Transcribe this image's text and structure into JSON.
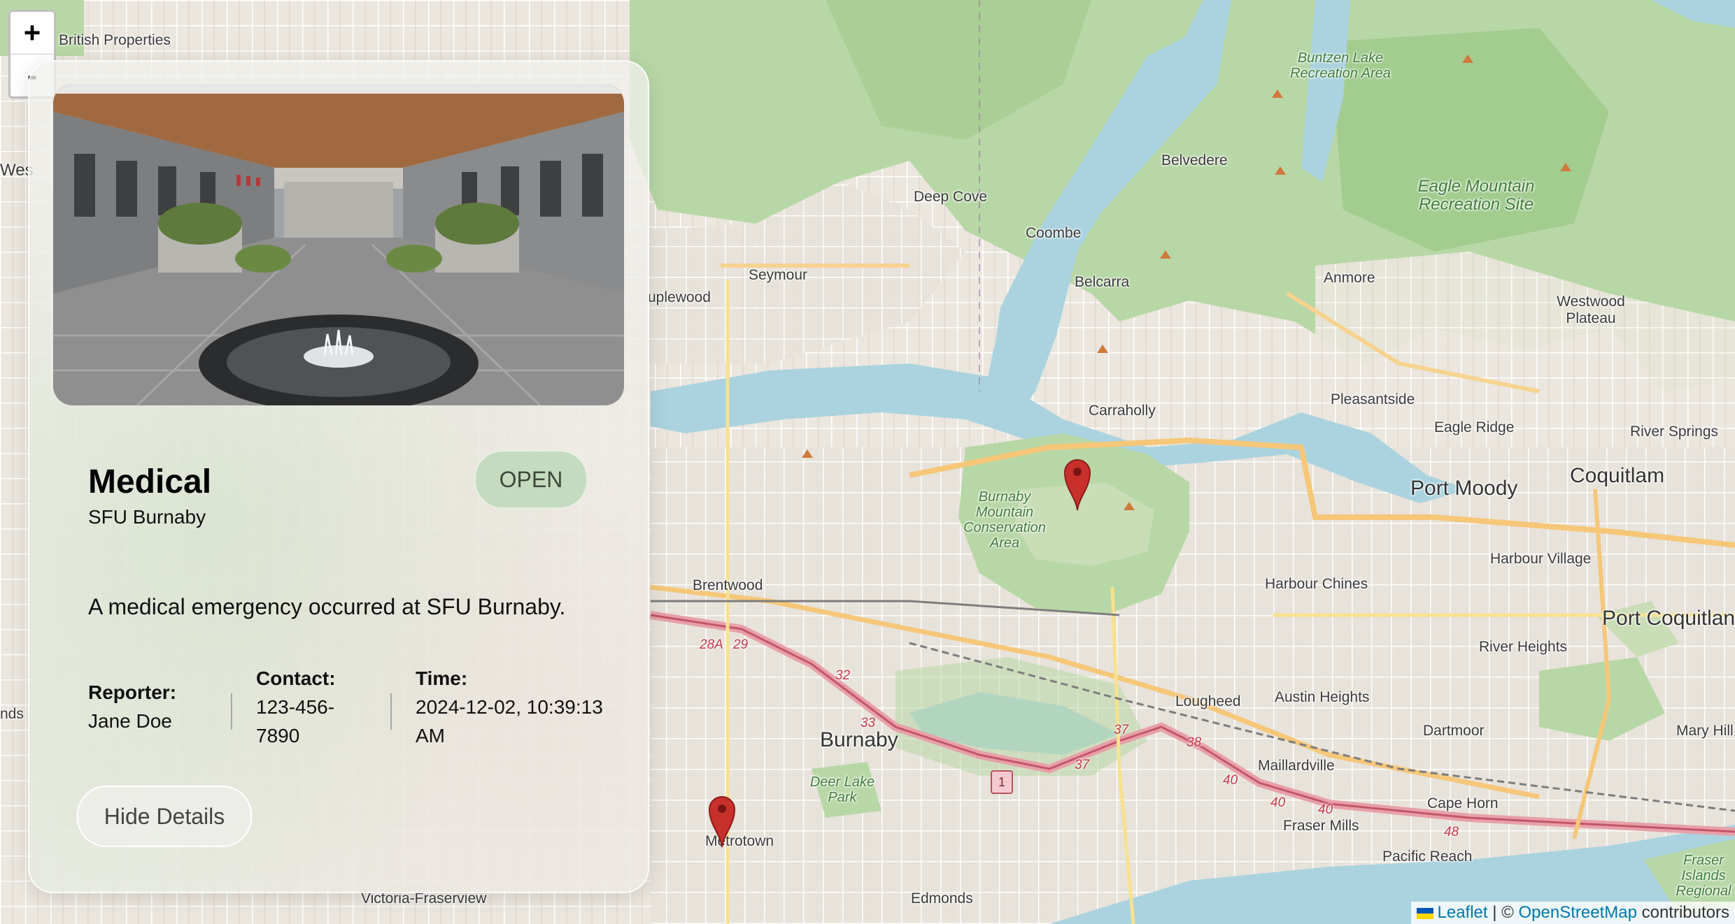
{
  "map": {
    "zoom_in_label": "+",
    "zoom_out_label": "-",
    "labels": {
      "british_properties": "British Properties",
      "west": "Wes",
      "uplewood": "uplewood",
      "seymour": "Seymour",
      "deep_cove": "Deep Cove",
      "coombe": "Coombe",
      "belvedere": "Belvedere",
      "belcarra": "Belcarra",
      "anmore": "Anmore",
      "westwood_plateau": "Westwood Plateau",
      "buntzen": "Buntzen Lake Recreation Area",
      "eagle_mountain": "Eagle Mountain Recreation Site",
      "carraholly": "Carraholly",
      "pleasantside": "Pleasantside",
      "eagle_ridge": "Eagle Ridge",
      "river_springs": "River Springs",
      "port_moody": "Port Moody",
      "coquitlam": "Coquitlam",
      "burnaby_mountain": "Burnaby Mountain Conservation Area",
      "brentwood": "Brentwood",
      "harbour_chines": "Harbour Chines",
      "harbour_village": "Harbour Village",
      "port_coquitlam": "Port Coquitlan",
      "river_heights": "River Heights",
      "austin_heights": "Austin Heights",
      "lougheed": "Lougheed",
      "burnaby": "Burnaby",
      "dartmoor": "Dartmoor",
      "mary_hill": "Mary Hill",
      "maillardville": "Maillardville",
      "cape_horn": "Cape Horn",
      "fraser_mills": "Fraser Mills",
      "pacific_reach": "Pacific Reach",
      "deer_lake_park": "Deer Lake Park",
      "metrotown": "Metrotown",
      "edmonds": "Edmonds",
      "victoria_fraserview": "Victoria-Fraserview",
      "fraser_islands": "Fraser Islands Regional",
      "nds": "nds"
    },
    "route_shields": [
      "28A",
      "29",
      "32",
      "33",
      "37",
      "37",
      "38",
      "40",
      "40",
      "40",
      "48"
    ],
    "highway_badge": "1",
    "marker_icon": "map-marker-icon"
  },
  "attribution": {
    "leaflet": "Leaflet",
    "separator": "| ©",
    "osm": "OpenStreetMap",
    "contributors": "contributors"
  },
  "incident": {
    "type": "Medical",
    "location": "SFU Burnaby",
    "status": "OPEN",
    "description": "A medical emergency occurred at SFU Burnaby.",
    "reporter_label": "Reporter:",
    "reporter": "Jane Doe",
    "contact_label": "Contact:",
    "contact_line1": "123-456-",
    "contact_line2": "7890",
    "time_label": "Time:",
    "time_line1": "2024-12-02, 10:39:13",
    "time_line2": "AM",
    "hide_button": "Hide Details"
  },
  "colors": {
    "water": "#aad3df",
    "forest": "#add19e",
    "urban": "#e9e4dc",
    "marker": "#c8302b",
    "status_bg": "#c5dbbf"
  }
}
